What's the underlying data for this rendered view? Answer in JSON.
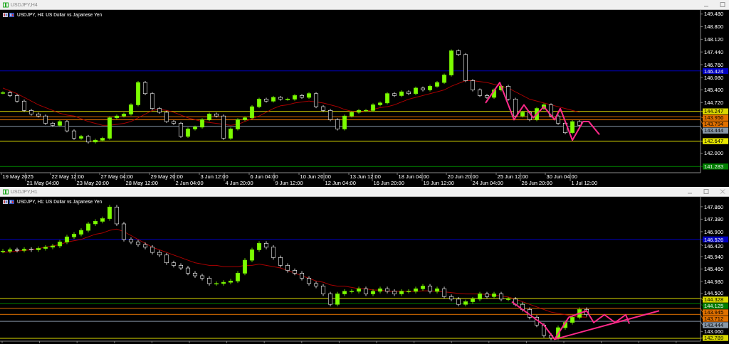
{
  "windows": [
    {
      "title": "USDJPY,H4",
      "legend": "USDJPY, H4:  US Dollar vs Japanese Yen",
      "price_axis": [
        "149.480",
        "148.800",
        "148.120",
        "147.440",
        "146.760",
        "146.080",
        "145.400",
        "144.720",
        "142.000"
      ],
      "time_axis": [
        "19 May 2025",
        "21 May 04:00",
        "22 May 12:00",
        "23 May 20:00",
        "27 May 04:00",
        "28 May 12:00",
        "29 May 20:00",
        "2 Jun 04:00",
        "3 Jun 12:00",
        "4 Jun 20:00",
        "6 Jun 04:00",
        "9 Jun 12:00",
        "10 Jun 20:00",
        "12 Jun 04:00",
        "13 Jun 12:00",
        "16 Jun 20:00",
        "18 Jun 04:00",
        "19 Jun 12:00",
        "20 Jun 20:00",
        "24 Jun 04:00",
        "25 Jun 12:00",
        "26 Jun 20:00",
        "30 Jun 04:00",
        "1 Jul 12:00"
      ],
      "levels": [
        {
          "label": "146.424",
          "color": "#0000c0"
        },
        {
          "label": "144.247",
          "color": "#d8d800"
        },
        {
          "label": "143.956",
          "color": "#e07000"
        },
        {
          "label": "143.794",
          "color": "#e07000"
        },
        {
          "label": "143.444",
          "color": "#8898a8"
        },
        {
          "label": "142.647",
          "color": "#e8e800"
        },
        {
          "label": "141.283",
          "color": "#008000"
        }
      ]
    },
    {
      "title": "USDJPY,H1",
      "legend": "USDJPY, H1:  US Dollar vs Japanese Yen",
      "price_axis": [
        "147.860",
        "147.380",
        "146.900",
        "146.420",
        "145.940",
        "145.460",
        "144.980",
        "144.500",
        "143.060"
      ],
      "levels": [
        {
          "label": "146.526",
          "color": "#0000c0"
        },
        {
          "label": "144.328",
          "color": "#d8d800"
        },
        {
          "label": "144.125",
          "color": "#008000"
        },
        {
          "label": "143.945",
          "color": "#e07000"
        },
        {
          "label": "143.712",
          "color": "#e07000"
        },
        {
          "label": "143.444",
          "color": "#8898a8"
        },
        {
          "label": "142.789",
          "color": "#d8d800"
        }
      ]
    }
  ]
}
